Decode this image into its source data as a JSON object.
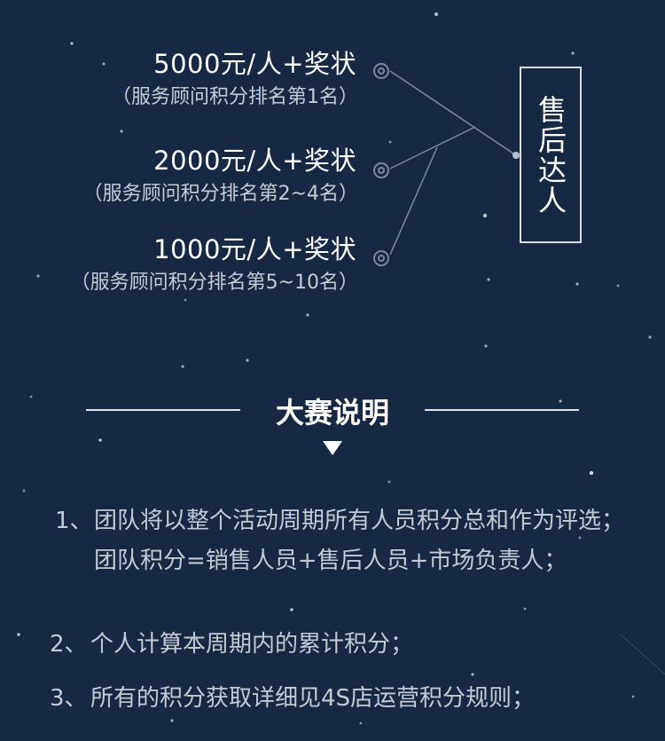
{
  "prizes": [
    {
      "amount": "5000元/人+奖状",
      "note": "（服务顾问积分排名第1名）"
    },
    {
      "amount": "2000元/人+奖状",
      "note": "（服务顾问积分排名第2~4名）"
    },
    {
      "amount": "1000元/人+奖状",
      "note": "（服务顾问积分排名第5~10名）"
    }
  ],
  "badge": {
    "label": "售后达人"
  },
  "section": {
    "title": "大赛说明"
  },
  "rules": [
    {
      "num": "1、",
      "text": "团队将以整个活动周期所有人员积分总和作为评选；团队积分=销售人员+售后人员+市场负责人；"
    },
    {
      "num": "2、",
      "text": "个人计算本周期内的累计积分；"
    },
    {
      "num": "3、",
      "text": "所有的积分获取详细见4S店运营积分规则；"
    }
  ],
  "colors": {
    "background": "#172845",
    "text": "#ffffff",
    "muted": "#c4cad4",
    "line": "#7e8797"
  }
}
